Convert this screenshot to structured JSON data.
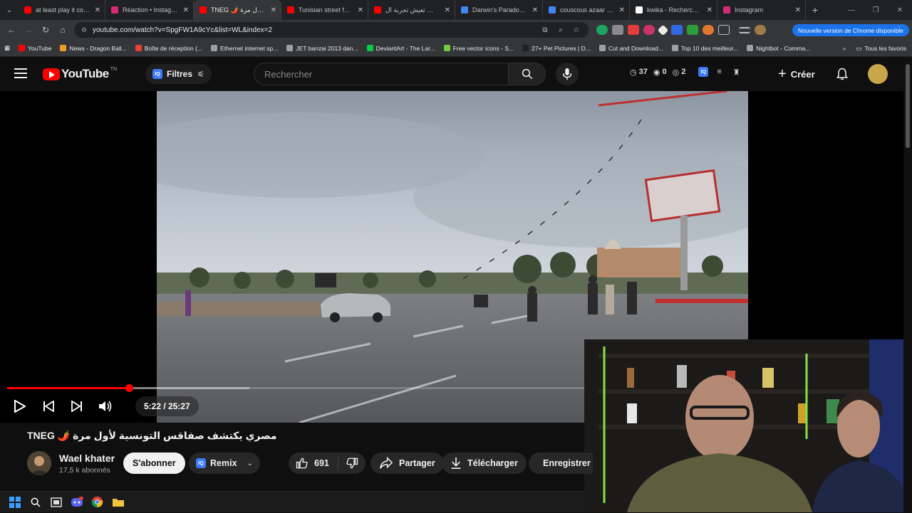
{
  "browser": {
    "tabs": [
      {
        "title": "at least play it cool -",
        "color": "#ff0000",
        "active": false
      },
      {
        "title": "Réaction • Instagram",
        "color": "#d62976",
        "active": false
      },
      {
        "title": "TNEG 🌶️ مصري يكتشف صفاقس التونسية لأول مرة",
        "color": "#ff0000",
        "active": true
      },
      {
        "title": "Tunisian street food",
        "color": "#ff0000",
        "active": false
      },
      {
        "title": "كيفاش تعيش تجربة ال",
        "color": "#ff0000",
        "active": false
      },
      {
        "title": "Darwin's Paradox! su",
        "color": "#4285f4",
        "active": false
      },
      {
        "title": "couscous azaar allou",
        "color": "#4285f4",
        "active": false
      },
      {
        "title": "kwika - Recherche Go",
        "color": "#ffffff",
        "active": false
      },
      {
        "title": "Instagram",
        "color": "#d62976",
        "active": false
      }
    ],
    "url": "youtube.com/watch?v=SpgFW1A9cYc&list=WL&index=2",
    "update_label": "Nouvelle version de Chrome disponible",
    "bookmarks": [
      "YouTube",
      "News - Dragon Ball...",
      "Boîte de réception (...",
      "Ethernet internet sp...",
      "JET banzai 2013 dan...",
      "DeviantArt - The Lar...",
      "Free vector icons - S...",
      "27+ Pet Pictures | D...",
      "Cut and Download...",
      "Top 10 des meilleur...",
      "Nightbot - Comma..."
    ],
    "bookmarks_right": "Tous les favoris"
  },
  "youtube": {
    "logo_text": "YouTube",
    "country": "TN",
    "filters_label": "Filtres",
    "search_placeholder": "Rechercher",
    "stats": {
      "watch": "37",
      "views": "0",
      "eye": "2"
    },
    "create_label": "Créer"
  },
  "player": {
    "current_time": "5:22",
    "duration": "25:27",
    "time_display": "5:22 / 25:27",
    "progress_fraction": 0.2109,
    "buffered_fraction": 0.42
  },
  "video": {
    "title": "TNEG 🌶️ مصري يكتشف صفاقس التونسية لأول مرة",
    "channel_name": "Wael khater",
    "subscribers": "17,5 k abonnés",
    "subscribe_label": "S'abonner",
    "remix_label": "Remix",
    "likes": "691",
    "share_label": "Partager",
    "download_label": "Télécharger",
    "save_label": "Enregistrer"
  },
  "colors": {
    "accent": "#ff0000",
    "chrome_blue": "#1a73e8",
    "bg": "#0f0f0f"
  }
}
